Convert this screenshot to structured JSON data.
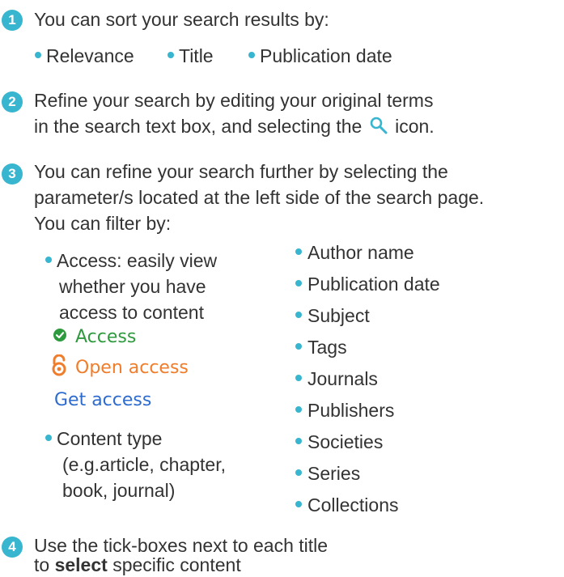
{
  "colors": {
    "accent": "#38b5cf",
    "text": "#333333",
    "access_green": "#2e9a3e",
    "open_orange": "#f07d2b",
    "link_blue": "#2d6bcf"
  },
  "steps": [
    {
      "number": "1",
      "lines": [
        "You can sort your search results by:"
      ],
      "sort_options": [
        "Relevance",
        "Title",
        "Publication date"
      ]
    },
    {
      "number": "2",
      "lines": [
        "Refine your search by editing your original terms"
      ],
      "line2_before": "in the search text box, and selecting the",
      "line2_after": "icon.",
      "icon": "search-icon"
    },
    {
      "number": "3",
      "lines": [
        "You can refine your search further by selecting the",
        "parameter/s located at the left side of the search page.",
        "You can filter by:"
      ]
    },
    {
      "number": "4",
      "lines": [
        "Use the tick-boxes next to each title"
      ],
      "line2_before": "to",
      "line2_bold": "select",
      "line2_after": "specific content"
    }
  ],
  "filters_left": {
    "access_lines": [
      "Access: easily view",
      "whether you have",
      "access to content"
    ],
    "statuses": {
      "access": "Access",
      "open_access": "Open access",
      "get_access": "Get access"
    },
    "content_type_lines": [
      "Content type",
      "(e.g.article, chapter,",
      "book, journal)"
    ]
  },
  "filters_right": [
    "Author name",
    "Publication date",
    "Subject",
    "Tags",
    "Journals",
    "Publishers",
    "Societies",
    "Series",
    "Collections"
  ]
}
